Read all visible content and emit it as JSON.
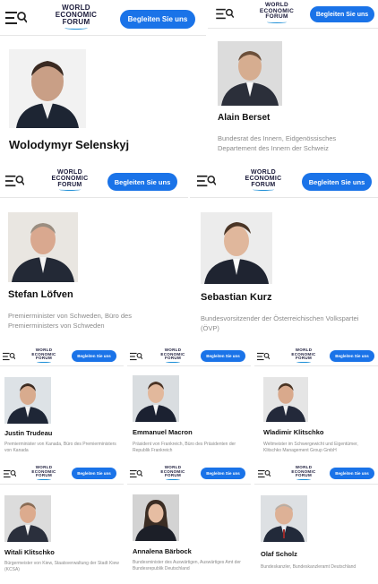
{
  "header": {
    "logo_line1": "WORLD",
    "logo_line2": "ECONOMIC",
    "logo_line3": "FORUM",
    "cta_label": "Begleiten Sie uns",
    "accent": "#1a73e8"
  },
  "profiles": [
    {
      "name": "Wolodymyr Selenskyj",
      "role": ""
    },
    {
      "name": "Alain Berset",
      "role": "Bundesrat des Innern, Eidgenössisches Departement des Innern der Schweiz"
    },
    {
      "name": "Stefan Löfven",
      "role": "Premierminister von Schweden, Büro des Premierministers von Schweden"
    },
    {
      "name": "Sebastian Kurz",
      "role": "Bundesvorsitzender der Österreichischen Volkspartei (ÖVP)"
    },
    {
      "name": "Justin Trudeau",
      "role": "Premierminister von Kanada, Büro des Premierministers von Kanada"
    },
    {
      "name": "Emmanuel Macron",
      "role": "Präsident von Frankreich, Büro des Präsidenten der Republik Frankreich"
    },
    {
      "name": "Wladimir Klitschko",
      "role": "Weltmeister im Schwergewicht und Eigentümer, Klitschko Management Group GmbH"
    },
    {
      "name": "Witali Klitschko",
      "role": "Bürgermeister von Kiew, Staatsverwaltung der Stadt Kiew (KCSA)"
    },
    {
      "name": "Annalena Bärbock",
      "role": "Bundesminister des Auswärtigen, Auswärtiges Amt der Bundesrepublik Deutschland"
    },
    {
      "name": "Olaf Scholz",
      "role": "Bundeskanzler, Bundeskanzleramt Deutschland"
    }
  ]
}
